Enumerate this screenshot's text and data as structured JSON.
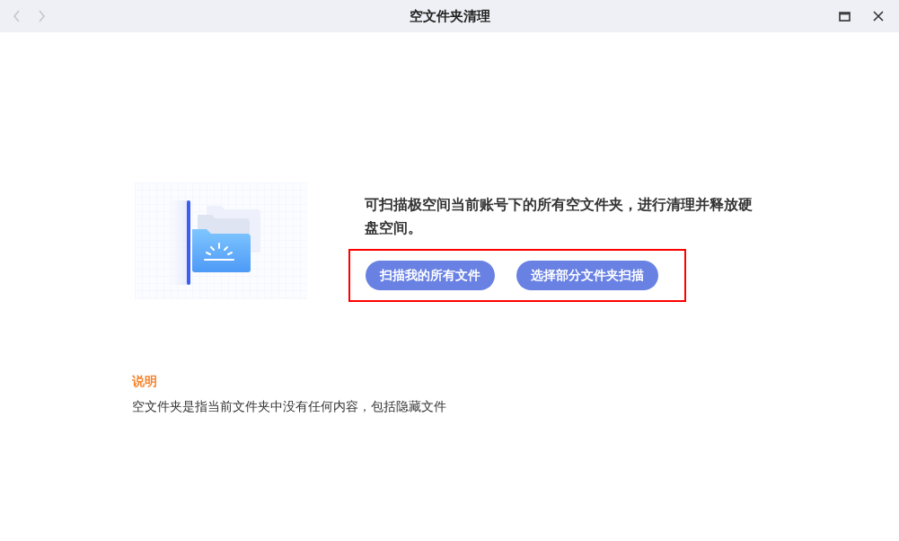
{
  "window": {
    "title": "空文件夹清理",
    "nav": [
      {
        "kind": "back",
        "disabled": true
      },
      {
        "kind": "forward",
        "disabled": true
      }
    ]
  },
  "intro": {
    "text": "可扫描极空间当前账号下的所有空文件夹，进行清理并释放硬盘空间。"
  },
  "actions": {
    "highlighted": true,
    "buttons": [
      "扫描我的所有文件",
      "选择部分文件夹扫描"
    ]
  },
  "note": {
    "heading": "说明",
    "text": "空文件夹是指当前文件夹中没有任何内容，包括隐藏文件"
  }
}
